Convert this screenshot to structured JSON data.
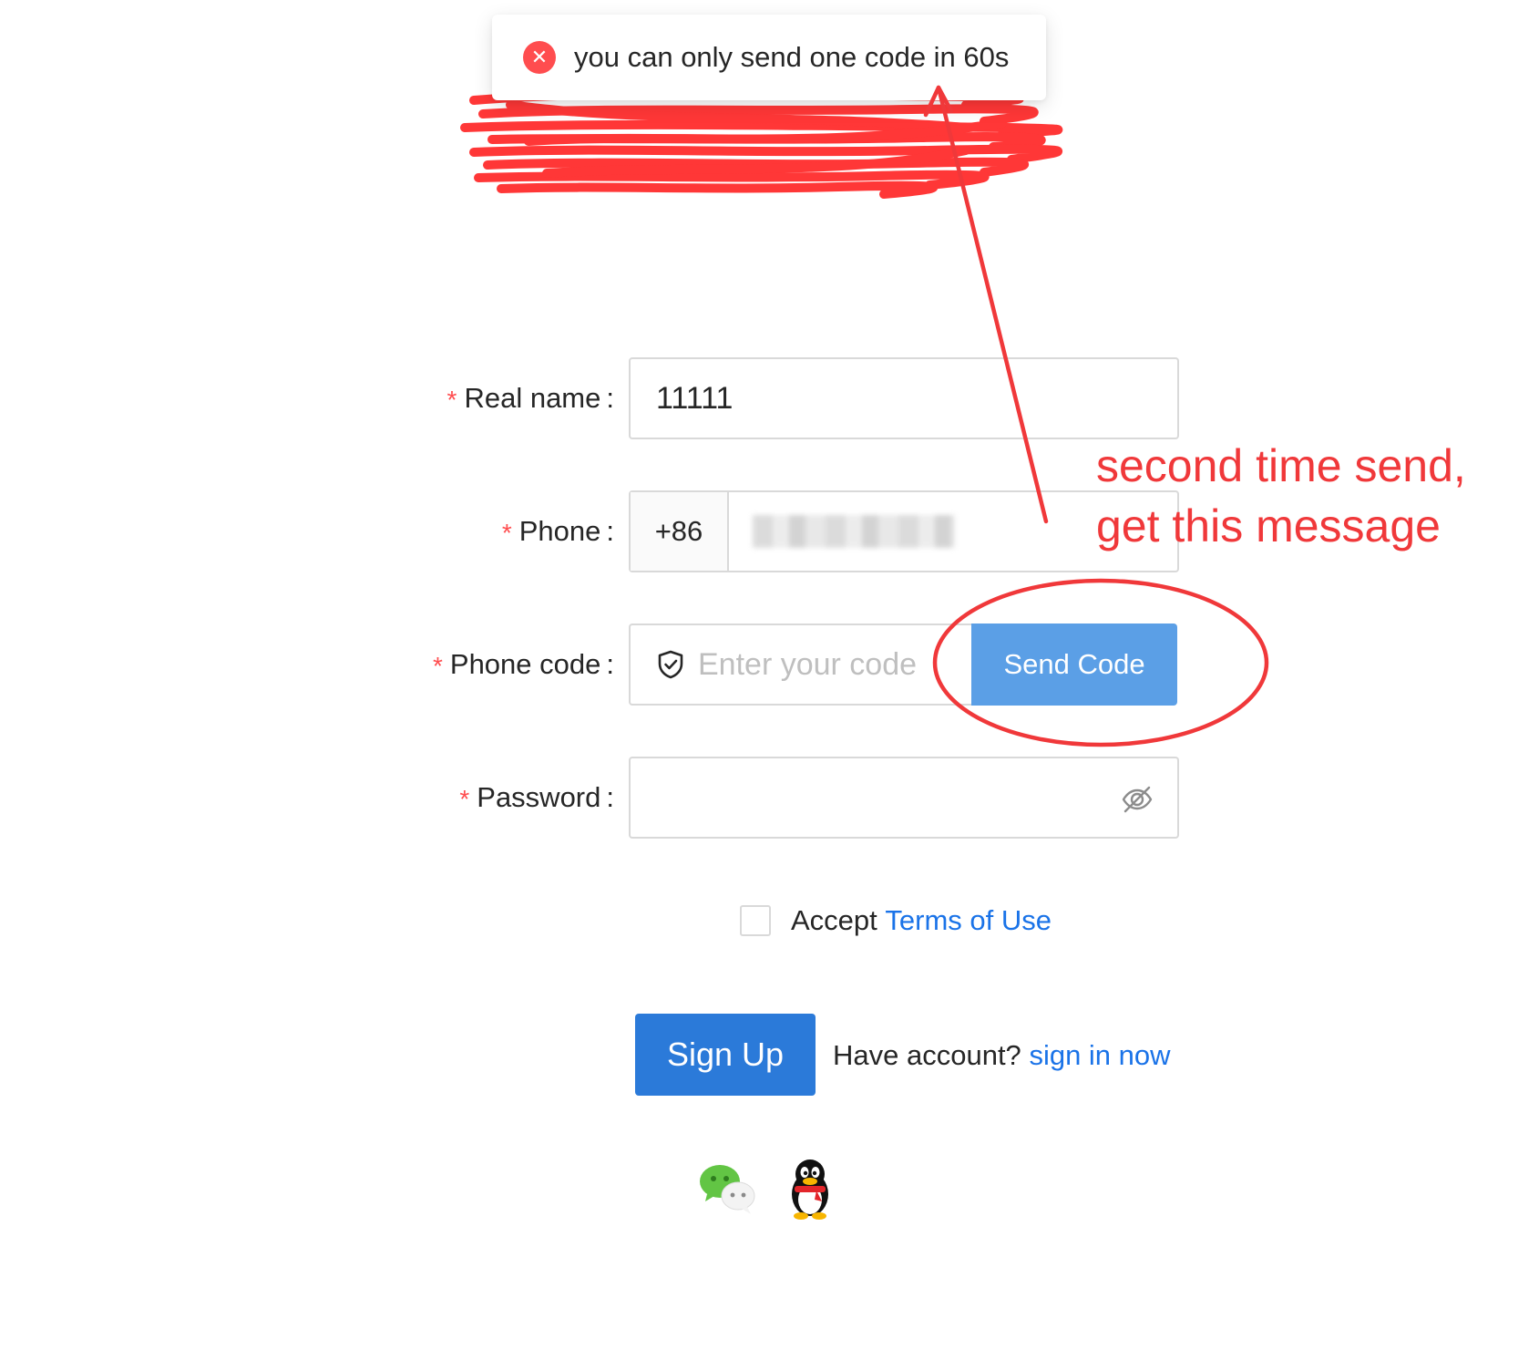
{
  "toast": {
    "icon": "close-circle-icon",
    "message": "you can only send one code in 60s",
    "color": "#ff4d4f"
  },
  "form": {
    "required_mark": "*",
    "colon": ":",
    "real_name": {
      "label": "Real name",
      "value": "11111"
    },
    "phone": {
      "label": "Phone",
      "prefix": "+86"
    },
    "phone_code": {
      "label": "Phone code",
      "placeholder": "Enter your code",
      "icon": "shield-check-icon",
      "send_button": "Send Code"
    },
    "password": {
      "label": "Password",
      "icon": "eye-invisible-icon"
    }
  },
  "terms": {
    "prefix": "Accept",
    "link": "Terms of Use"
  },
  "actions": {
    "signup": "Sign Up",
    "have_account": "Have account?",
    "signin_link": "sign in now"
  },
  "social": {
    "wechat_icon": "wechat-icon",
    "qq_icon": "qq-penguin-icon"
  },
  "annotation": {
    "line1": "second time send,",
    "line2": "get this message",
    "color": "#f0383a"
  },
  "colors": {
    "primary": "#2b7ad9",
    "send_code_bg": "#5b9fe6",
    "link": "#1a73e8",
    "error": "#ff4d4f"
  }
}
